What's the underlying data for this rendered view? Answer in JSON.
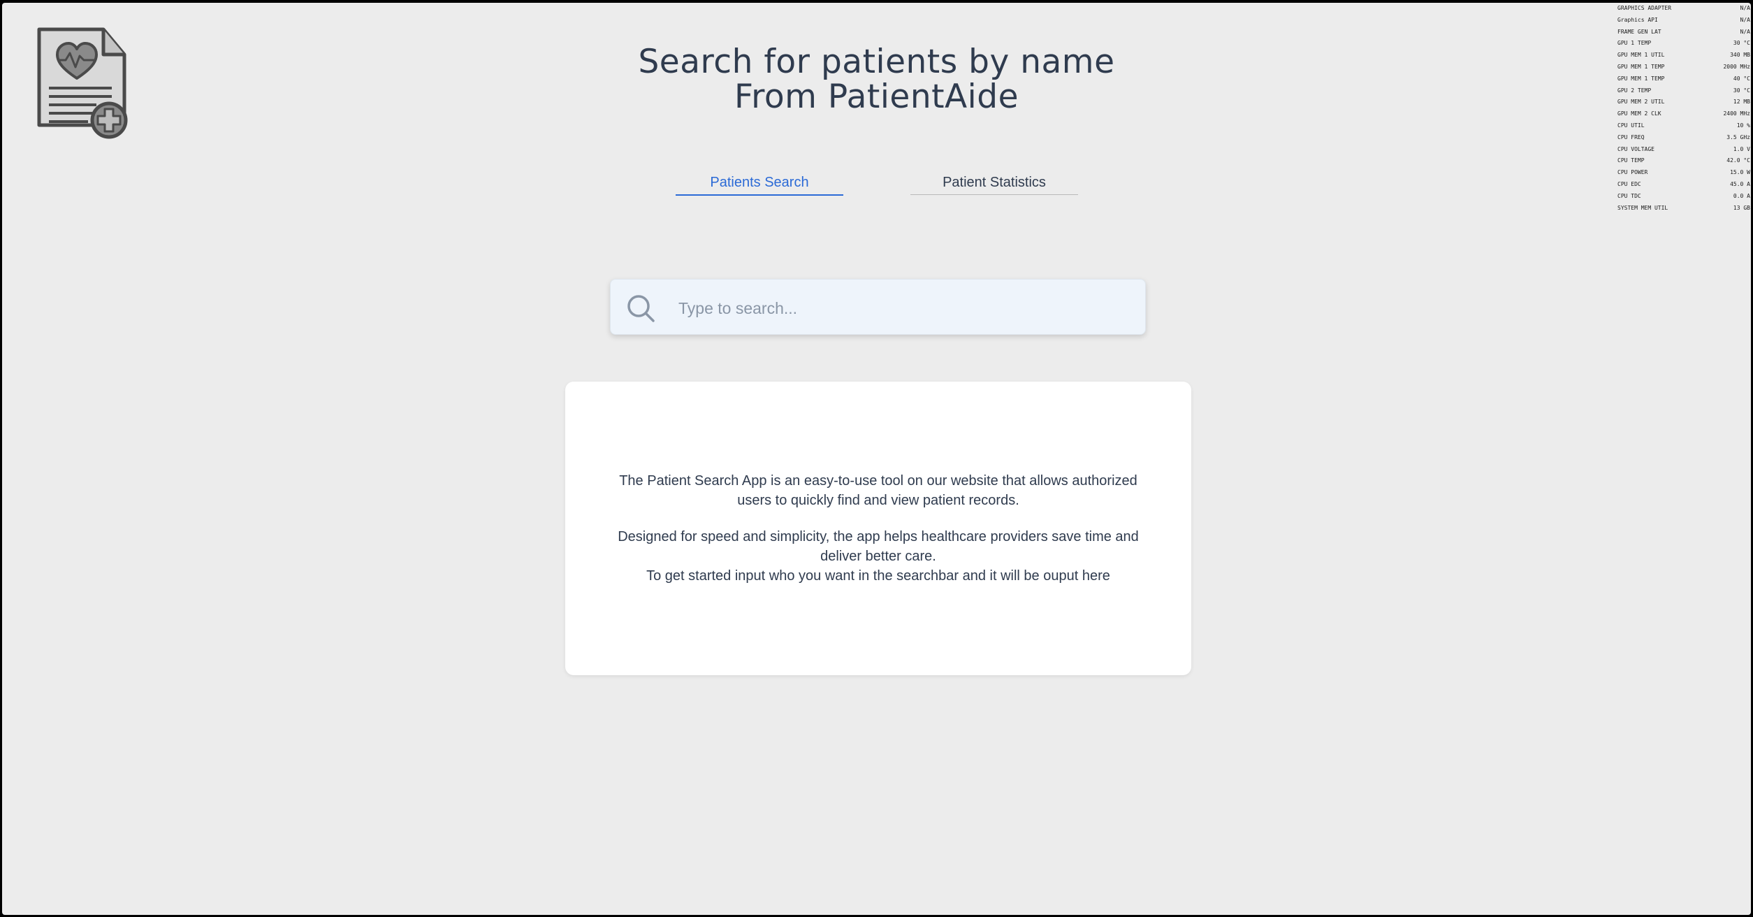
{
  "header": {
    "title_line1": "Search for patients by name",
    "title_line2": "From PatientAide",
    "logo_icon": "medical-record-icon"
  },
  "tabs": [
    {
      "label": "Patients Search",
      "active": true
    },
    {
      "label": "Patient Statistics",
      "active": false
    }
  ],
  "search": {
    "placeholder": "Type to search...",
    "value": "",
    "icon": "search-icon"
  },
  "card": {
    "paragraph1": "The Patient Search App is an easy-to-use tool on our website that allows authorized users to quickly find and view patient records.",
    "paragraph2_line1": "Designed for speed and simplicity, the app helps healthcare providers save time and deliver better care.",
    "paragraph2_line2": "To get started input who you want in the searchbar and it will be ouput here"
  },
  "system_monitor": [
    {
      "label": "GRAPHICS ADAPTER",
      "value": "N/A"
    },
    {
      "label": "Graphics API",
      "value": "N/A"
    },
    {
      "label": "FRAME GEN LAT",
      "value": "N/A"
    },
    {
      "label": "GPU 1 TEMP",
      "value": "30 °C"
    },
    {
      "label": "GPU MEM 1 UTIL",
      "value": "340 MB"
    },
    {
      "label": "GPU MEM 1 TEMP",
      "value": "2000 MHz"
    },
    {
      "label": "GPU MEM 1 TEMP",
      "value": "40 °C"
    },
    {
      "label": "GPU 2 TEMP",
      "value": "30 °C"
    },
    {
      "label": "GPU MEM 2 UTIL",
      "value": "12 MB"
    },
    {
      "label": "GPU MEM 2 CLK",
      "value": "2400 MHz"
    },
    {
      "label": "CPU UTIL",
      "value": "10 %"
    },
    {
      "label": "CPU FREQ",
      "value": "3.5 GHz"
    },
    {
      "label": "CPU VOLTAGE",
      "value": "1.0 V"
    },
    {
      "label": "CPU TEMP",
      "value": "42.0 °C"
    },
    {
      "label": "CPU POWER",
      "value": "15.0 W"
    },
    {
      "label": "CPU EDC",
      "value": "45.0 A"
    },
    {
      "label": "CPU TDC",
      "value": "0.0 A"
    },
    {
      "label": "SYSTEM MEM UTIL",
      "value": "13 GB"
    }
  ]
}
